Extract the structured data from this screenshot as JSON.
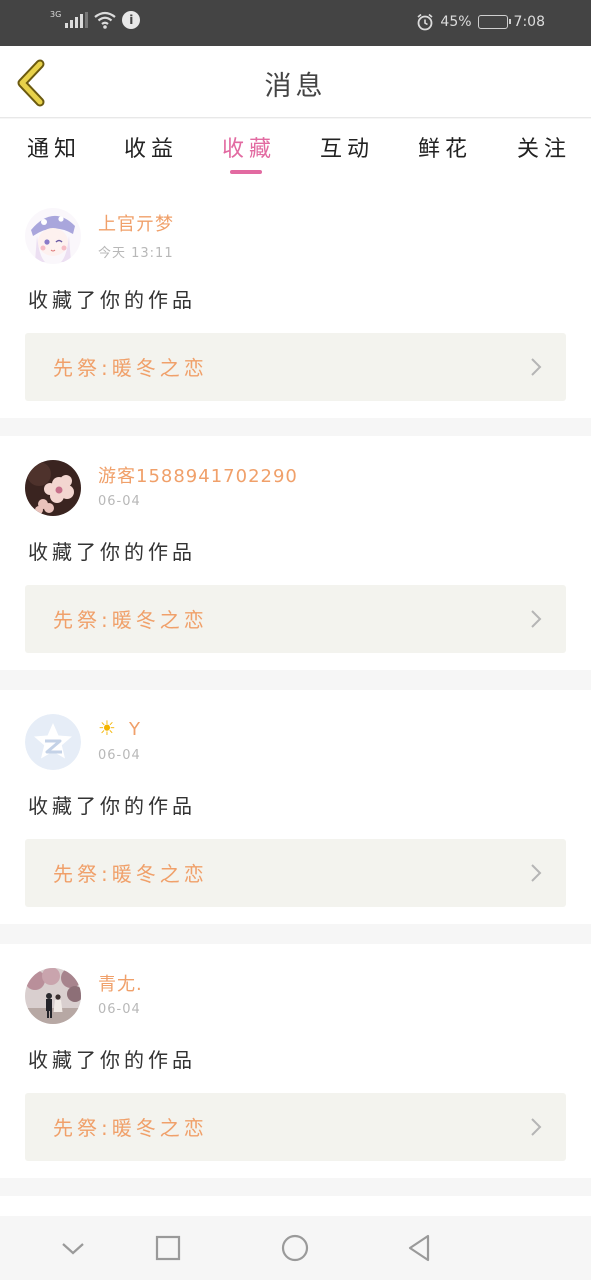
{
  "status_bar": {
    "signal_label": "3G",
    "battery": "45%",
    "battery_level": 0.45,
    "time": "7:08",
    "icons": [
      "signal-icon",
      "wifi-icon",
      "info-icon",
      "alarm-icon",
      "battery-icon"
    ]
  },
  "header": {
    "title": "消息",
    "back_icon": "chevron-left-icon"
  },
  "tabs": [
    {
      "label": "通知",
      "active": false
    },
    {
      "label": "收益",
      "active": false
    },
    {
      "label": "收藏",
      "active": true
    },
    {
      "label": "互动",
      "active": false
    },
    {
      "label": "鲜花",
      "active": false
    },
    {
      "label": "关注",
      "active": false
    }
  ],
  "messages": [
    {
      "username": "上官亓梦",
      "time": "今天 13:11",
      "action": "收藏了你的作品",
      "work_title": "先祭:暖冬之恋",
      "avatar": "anime-girl-avatar"
    },
    {
      "username": "游客1588941702290",
      "time": "06-04",
      "action": "收藏了你的作品",
      "work_title": "先祭:暖冬之恋",
      "avatar": "flower-avatar"
    },
    {
      "username": "Y",
      "time": "06-04",
      "action": "收藏了你的作品",
      "work_title": "先祭:暖冬之恋",
      "avatar": "qzone-avatar"
    },
    {
      "username": "青尢.",
      "time": "06-04",
      "action": "收藏了你的作品",
      "work_title": "先祭:暖冬之恋",
      "avatar": "couple-photo-avatar"
    }
  ],
  "colors": {
    "accent": "#e26aa1",
    "name": "#f0a06a",
    "back_icon": "#e8d24a"
  },
  "nav_bar": [
    "chevron-down-icon",
    "square-icon",
    "circle-icon",
    "triangle-back-icon"
  ]
}
